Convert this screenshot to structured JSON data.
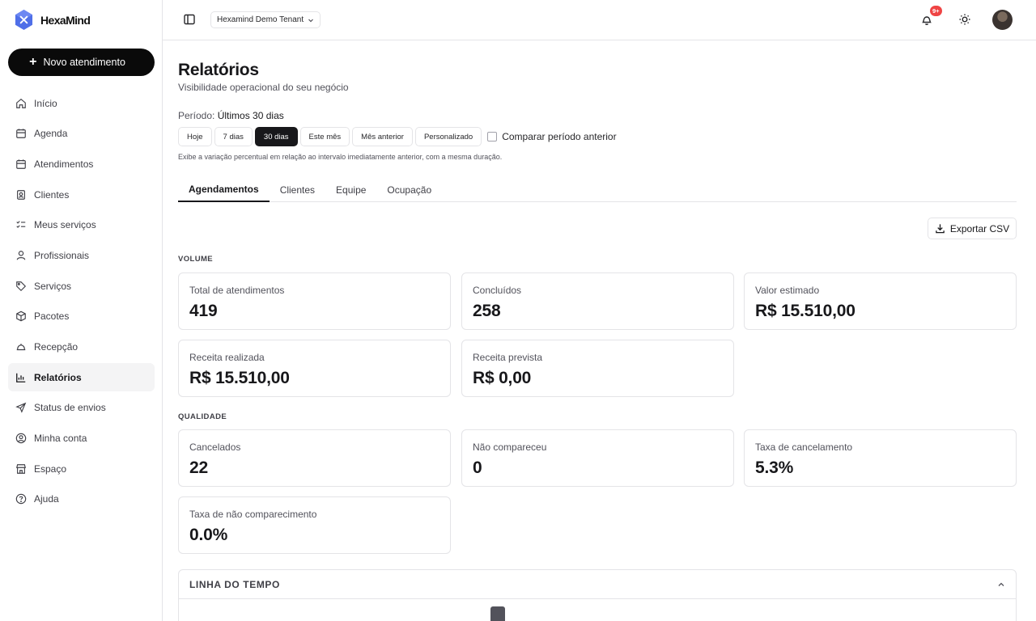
{
  "brand": {
    "name": "HexaMind",
    "accent": "#4f6fe8"
  },
  "sidebar": {
    "new_button": "Novo atendimento",
    "items": [
      {
        "label": "Início",
        "icon": "home-icon"
      },
      {
        "label": "Agenda",
        "icon": "calendar-icon"
      },
      {
        "label": "Atendimentos",
        "icon": "calendar-check-icon"
      },
      {
        "label": "Clientes",
        "icon": "contacts-icon"
      },
      {
        "label": "Meus serviços",
        "icon": "list-check-icon"
      },
      {
        "label": "Profissionais",
        "icon": "user-icon"
      },
      {
        "label": "Serviços",
        "icon": "tag-icon"
      },
      {
        "label": "Pacotes",
        "icon": "package-icon"
      },
      {
        "label": "Recepção",
        "icon": "bell-service-icon"
      },
      {
        "label": "Relatórios",
        "icon": "bar-chart-icon",
        "active": true
      },
      {
        "label": "Status de envios",
        "icon": "send-icon"
      },
      {
        "label": "Minha conta",
        "icon": "user-circle-icon"
      },
      {
        "label": "Espaço",
        "icon": "store-icon"
      },
      {
        "label": "Ajuda",
        "icon": "help-circle-icon"
      }
    ]
  },
  "header": {
    "tenant": "Hexamind Demo Tenant",
    "notifications_badge": "9+"
  },
  "page": {
    "title": "Relatórios",
    "subtitle": "Visibilidade operacional do seu negócio",
    "period_label": "Período:",
    "period_value": "Últimos 30 dias",
    "ranges": [
      "Hoje",
      "7 dias",
      "30 dias",
      "Este mês",
      "Mês anterior",
      "Personalizado"
    ],
    "active_range": "30 dias",
    "compare_label": "Comparar período anterior",
    "range_hint": "Exibe a variação percentual em relação ao intervalo imediatamente anterior, com a mesma duração.",
    "tabs": [
      "Agendamentos",
      "Clientes",
      "Equipe",
      "Ocupação"
    ],
    "active_tab": "Agendamentos",
    "export_label": "Exportar CSV"
  },
  "volume": {
    "label": "VOLUME",
    "cards": [
      {
        "label": "Total de atendimentos",
        "value": "419"
      },
      {
        "label": "Concluídos",
        "value": "258"
      },
      {
        "label": "Valor estimado",
        "value": "R$ 15.510,00"
      },
      {
        "label": "Receita realizada",
        "value": "R$ 15.510,00"
      },
      {
        "label": "Receita prevista",
        "value": "R$ 0,00"
      }
    ]
  },
  "quality": {
    "label": "QUALIDADE",
    "cards": [
      {
        "label": "Cancelados",
        "value": "22"
      },
      {
        "label": "Não compareceu",
        "value": "0"
      },
      {
        "label": "Taxa de cancelamento",
        "value": "5.3%"
      },
      {
        "label": "Taxa de não comparecimento",
        "value": "0.0%"
      }
    ]
  },
  "timeline": {
    "title": "LINHA DO TEMPO"
  }
}
